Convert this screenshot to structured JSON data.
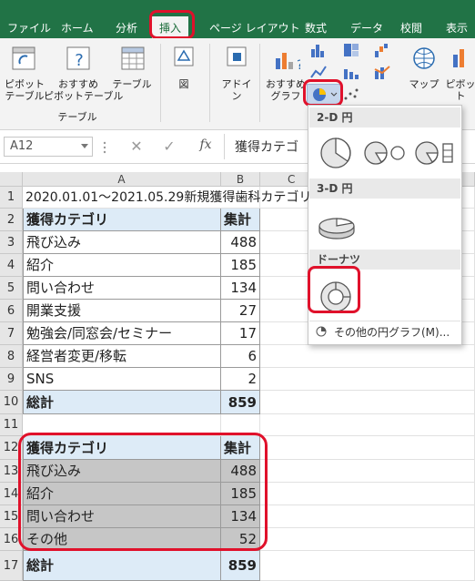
{
  "tabs": [
    "ファイル",
    "ホーム",
    "分析",
    "挿入",
    "ページ レイアウト",
    "数式",
    "データ",
    "校閲",
    "表示"
  ],
  "ribbon": {
    "pivot_table": "ピボット\nテーブル",
    "recommended_pivot": "おすすめ\nピボットテーブル",
    "table": "テーブル",
    "group_table": "テーブル",
    "figure": "図",
    "addins": "アドイ\nン",
    "recommended_chart": "おすすめ\nグラフ",
    "map": "マップ",
    "pivot_chart": "ピボット"
  },
  "formula_bar": {
    "name_box": "A12",
    "fx": "fx",
    "formula": "獲得カテゴ"
  },
  "columns": [
    "A",
    "B",
    "C"
  ],
  "rows": [
    {
      "n": "1",
      "a": "2020.01.01～2021.05.29新規獲得歯科カテゴリ",
      "b": ""
    },
    {
      "n": "2",
      "a": "獲得カテゴリ",
      "b": "集計"
    },
    {
      "n": "3",
      "a": "飛び込み",
      "b": "488"
    },
    {
      "n": "4",
      "a": "紹介",
      "b": "185"
    },
    {
      "n": "5",
      "a": "問い合わせ",
      "b": "134"
    },
    {
      "n": "6",
      "a": "開業支援",
      "b": "27"
    },
    {
      "n": "7",
      "a": "勉強会/同窓会/セミナー",
      "b": "17"
    },
    {
      "n": "8",
      "a": "経営者変更/移転",
      "b": "6"
    },
    {
      "n": "9",
      "a": "SNS",
      "b": "2"
    },
    {
      "n": "10",
      "a": "総計",
      "b": "859"
    },
    {
      "n": "11",
      "a": "",
      "b": ""
    },
    {
      "n": "12",
      "a": "獲得カテゴリ",
      "b": "集計"
    },
    {
      "n": "13",
      "a": "飛び込み",
      "b": "488"
    },
    {
      "n": "14",
      "a": "紹介",
      "b": "185"
    },
    {
      "n": "15",
      "a": "問い合わせ",
      "b": "134"
    },
    {
      "n": "16",
      "a": "その他",
      "b": "52"
    },
    {
      "n": "17",
      "a": "総計",
      "b": "859"
    }
  ],
  "dropdown": {
    "sec2d": "2-D 円",
    "sec3d": "3-D 円",
    "secdonut": "ドーナツ",
    "more": "その他の円グラフ(M)..."
  },
  "colors": {
    "excel_green": "#217346",
    "header_blue": "#ddebf7",
    "selection_gray": "#c6c6c6",
    "highlight_red": "#e0112b"
  }
}
